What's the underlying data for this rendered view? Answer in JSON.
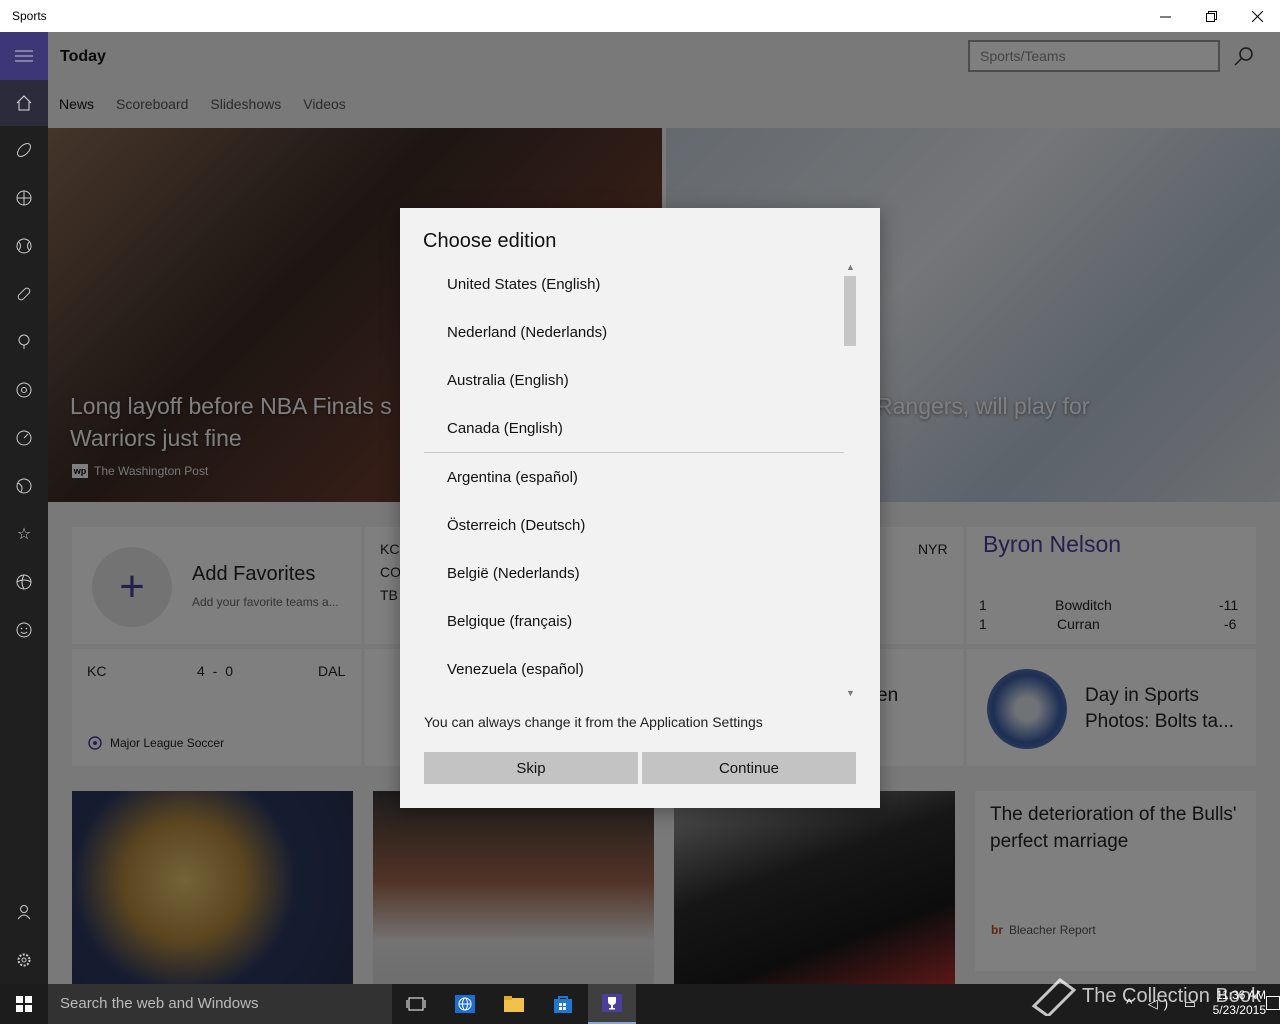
{
  "window": {
    "title": "Sports"
  },
  "header": {
    "page_title": "Today",
    "search_placeholder": "Sports/Teams",
    "tabs": [
      "News",
      "Scoreboard",
      "Slideshows",
      "Videos"
    ]
  },
  "hero": {
    "left_headline_line1": "Long layoff before NBA Finals s",
    "left_headline_line2": "Warriors just fine",
    "left_source": "The Washington Post",
    "left_source_logo": "wp",
    "right_headline": "Rangers, will play for"
  },
  "tiles": {
    "favorites_title": "Add Favorites",
    "favorites_subtitle": "Add your favorite teams a...",
    "score1_team1": "KC",
    "score1_team2": "CO",
    "score1_team3": "TB",
    "score1_right": "NYR",
    "golf_title": "Byron Nelson",
    "golf_rows": [
      {
        "pos": "1",
        "name": "Bowditch",
        "score": "-11"
      },
      {
        "pos": "1",
        "name": "Curran",
        "score": "-6"
      }
    ],
    "match_home": "KC",
    "match_score": "4 - 0",
    "match_away": "DAL",
    "match_league": "Major League Soccer",
    "partial_text": "en",
    "slideshow_title": "Day in Sports Photos: Bolts ta...",
    "article_title": "The deterioration of the Bulls' perfect marriage",
    "article_source": "Bleacher Report",
    "article_source_logo": "br"
  },
  "dialog": {
    "title": "Choose edition",
    "options_group1": [
      "United States (English)",
      "Nederland (Nederlands)",
      "Australia (English)",
      "Canada (English)"
    ],
    "options_group2": [
      "Argentina (español)",
      "Österreich (Deutsch)",
      "België (Nederlands)",
      "Belgique (français)",
      "Venezuela (español)"
    ],
    "note": "You can always change it from the Application Settings",
    "skip_label": "Skip",
    "continue_label": "Continue"
  },
  "taskbar": {
    "search_placeholder": "Search the web and Windows",
    "time": "11:36 AM",
    "date": "5/23/2015"
  },
  "watermark": "The Collection Book",
  "colors": {
    "accent": "#3d3777",
    "sidebar": "#1f1f1f",
    "taskbar": "#1c1c1c"
  }
}
